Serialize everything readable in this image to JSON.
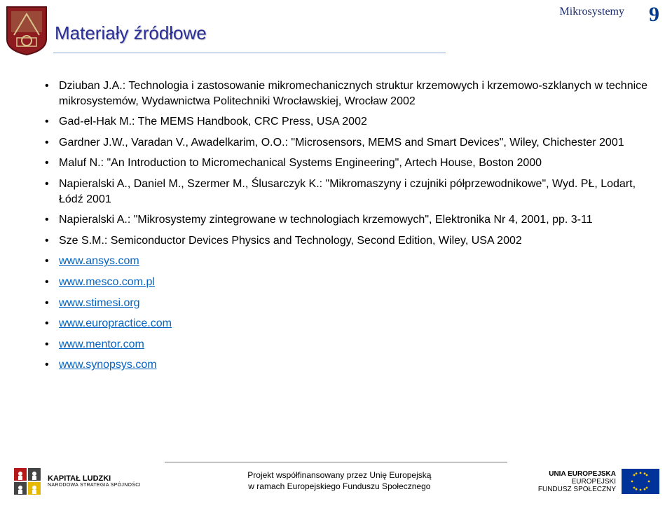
{
  "header": {
    "top_label": "Mikrosystemy",
    "page_number": "9",
    "title": "Materiały źródłowe"
  },
  "bullets": [
    {
      "text": "Dziuban J.A.: Technologia i zastosowanie mikromechanicznych struktur krzemowych i krzemowo-szklanych w technice mikrosystemów, Wydawnictwa Politechniki Wrocławskiej, Wrocław 2002",
      "link": false
    },
    {
      "text": "Gad-el-Hak M.: The MEMS Handbook, CRC Press, USA 2002",
      "link": false
    },
    {
      "text": "Gardner J.W., Varadan V., Awadelkarim, O.O.: \"Microsensors, MEMS and Smart Devices\", Wiley, Chichester 2001",
      "link": false
    },
    {
      "text": "Maluf N.: \"An Introduction to Micromechanical Systems Engineering\", Artech House, Boston 2000",
      "link": false
    },
    {
      "text": "Napieralski A., Daniel M., Szermer M., Ślusarczyk K.: \"Mikromaszyny i czujniki półprzewodnikowe\", Wyd. PŁ, Lodart, Łódź 2001",
      "link": false
    },
    {
      "text": "Napieralski A.: \"Mikrosystemy zintegrowane w technologiach krzemowych\", Elektronika Nr 4, 2001, pp. 3-11",
      "link": false
    },
    {
      "text": "Sze S.M.: Semiconductor Devices Physics and Technology, Second Edition, Wiley, USA 2002",
      "link": false
    },
    {
      "text": "www.ansys.com",
      "link": true
    },
    {
      "text": "www.mesco.com.pl",
      "link": true
    },
    {
      "text": "www.stimesi.org",
      "link": true
    },
    {
      "text": "www.europractice.com",
      "link": true
    },
    {
      "text": "www.mentor.com",
      "link": true
    },
    {
      "text": "www.synopsys.com",
      "link": true
    }
  ],
  "footer": {
    "line1": "Projekt współfinansowany przez Unię Europejską",
    "line2": "w ramach Europejskiego Funduszu Społecznego",
    "kl_title": "KAPITAŁ LUDZKI",
    "kl_sub": "NARODOWA STRATEGIA SPÓJNOŚCI",
    "eu_title": "UNIA EUROPEJSKA",
    "eu_sub1": "EUROPEJSKI",
    "eu_sub2": "FUNDUSZ SPOŁECZNY"
  }
}
